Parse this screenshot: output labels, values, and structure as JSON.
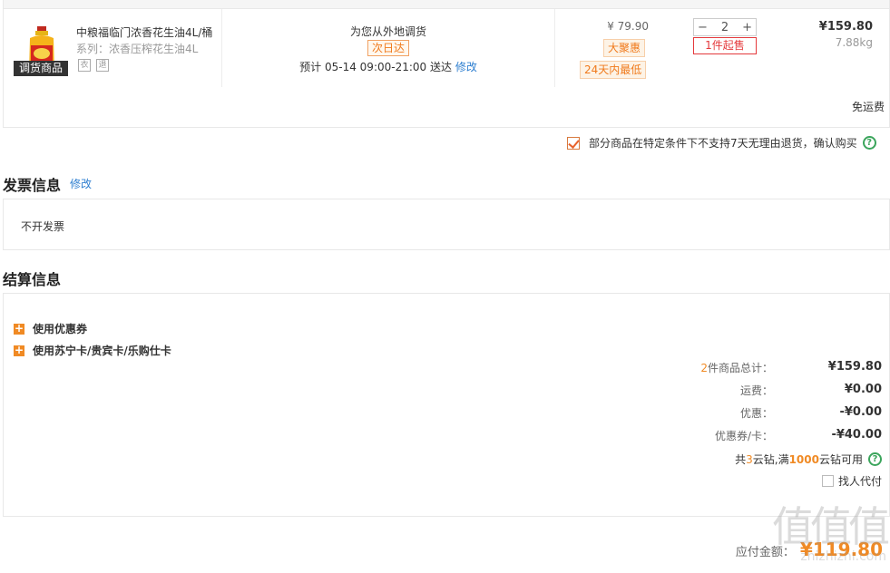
{
  "product": {
    "name": "中粮福临门浓香花生油4L/桶",
    "series": "系列：浓香压榨花生油4L",
    "badge": "调货商品",
    "service_icons": [
      "cloth-icon",
      "return-icon"
    ],
    "ship_note": "为您从外地调货",
    "ship_tag": "次日达",
    "eta_prefix": "预计  05-14  09:00-21:00  送达",
    "eta_edit": "修改",
    "unit_price": "¥ 79.90",
    "tag_promo": "大聚惠",
    "tag_lowest": "24天内最低",
    "qty": "2",
    "qty_minus": "−",
    "qty_plus": "+",
    "min_order": "1件起售",
    "subtotal": "¥159.80",
    "weight": "7.88kg",
    "free_shipping": "免运费",
    "accent": "#f08a24"
  },
  "agreement": {
    "text": "部分商品在特定条件下不支持7天无理由退货，确认购买",
    "help": "?"
  },
  "invoice": {
    "title": "发票信息",
    "edit": "修改",
    "value": "不开发票"
  },
  "settlement": {
    "title": "结算信息",
    "options": [
      "使用优惠券",
      "使用苏宁卡/贵宾卡/乐购仕卡"
    ],
    "items_count": "2",
    "items_label": "件商品总计：",
    "items_total": "¥159.80",
    "shipping_label": "运费：",
    "shipping_value": "¥0.00",
    "discount_label": "优惠：",
    "discount_value": "-¥0.00",
    "coupon_label": "优惠券/卡：",
    "coupon_value": "-¥40.00",
    "coin_prefix": "共 ",
    "coin_count": "3",
    "coin_mid": "云钻,满",
    "coin_threshold": "1000",
    "coin_suffix": "云钻可用",
    "proxy_pay": "找人代付",
    "payable_label": "应付金额：",
    "payable_value": "¥119.80"
  },
  "watermark": {
    "big": "值值值",
    "small": "zhizhizhi.com"
  }
}
